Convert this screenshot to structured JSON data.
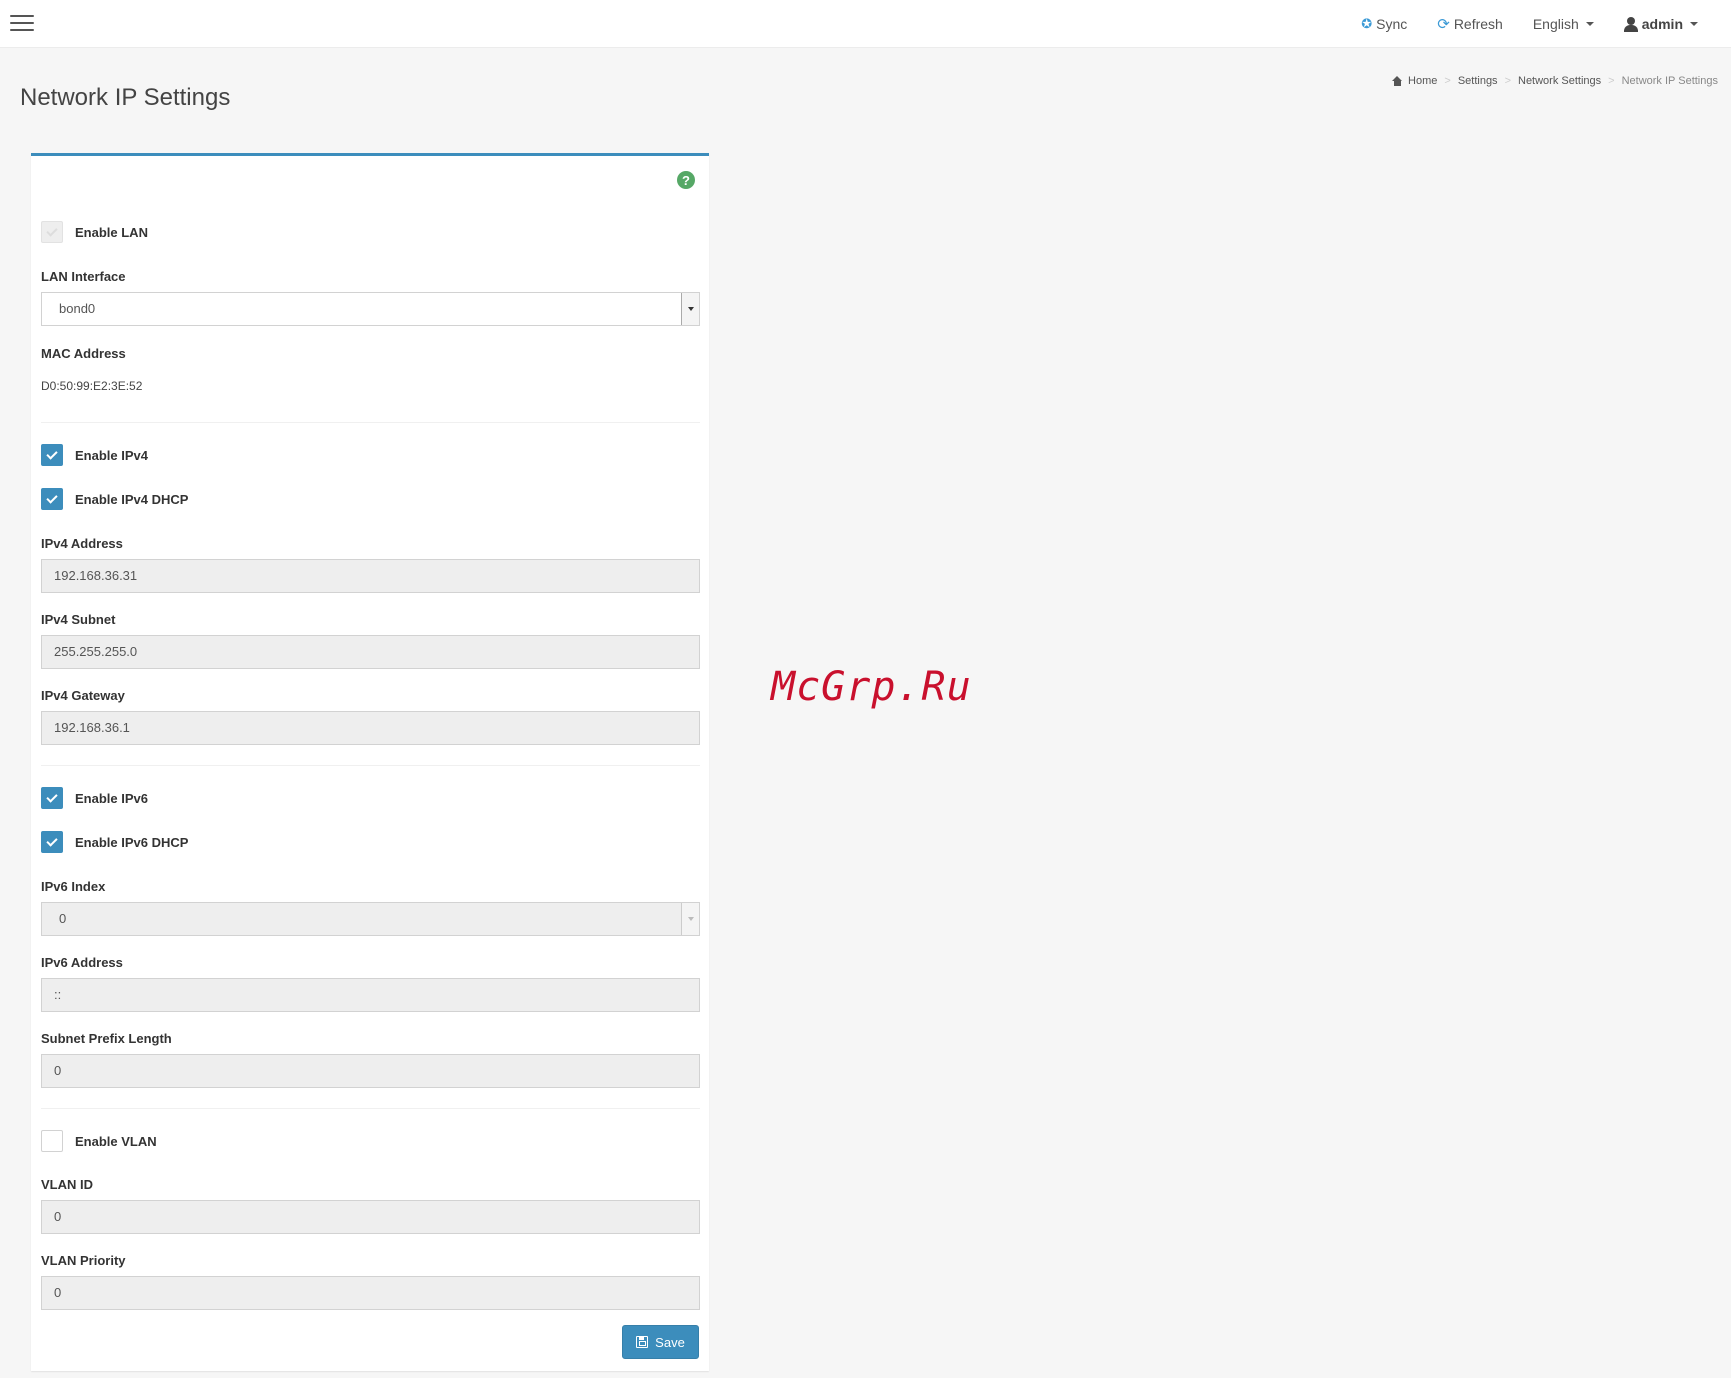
{
  "topbar": {
    "sync_label": "Sync",
    "refresh_label": "Refresh",
    "language_label": "English",
    "user_label": "admin"
  },
  "page": {
    "title": "Network IP Settings"
  },
  "breadcrumb": {
    "home": "Home",
    "settings": "Settings",
    "network_settings": "Network Settings",
    "current": "Network IP Settings"
  },
  "form": {
    "enable_lan": {
      "label": "Enable LAN",
      "checked": true,
      "disabled": true
    },
    "lan_interface": {
      "label": "LAN Interface",
      "value": "bond0"
    },
    "mac_address": {
      "label": "MAC Address",
      "value": "D0:50:99:E2:3E:52"
    },
    "enable_ipv4": {
      "label": "Enable IPv4",
      "checked": true
    },
    "enable_ipv4_dhcp": {
      "label": "Enable IPv4 DHCP",
      "checked": true
    },
    "ipv4_address": {
      "label": "IPv4 Address",
      "value": "192.168.36.31"
    },
    "ipv4_subnet": {
      "label": "IPv4 Subnet",
      "value": "255.255.255.0"
    },
    "ipv4_gateway": {
      "label": "IPv4 Gateway",
      "value": "192.168.36.1"
    },
    "enable_ipv6": {
      "label": "Enable IPv6",
      "checked": true
    },
    "enable_ipv6_dhcp": {
      "label": "Enable IPv6 DHCP",
      "checked": true
    },
    "ipv6_index": {
      "label": "IPv6 Index",
      "value": "0"
    },
    "ipv6_address": {
      "label": "IPv6 Address",
      "value": "::"
    },
    "subnet_prefix_length": {
      "label": "Subnet Prefix Length",
      "value": "0"
    },
    "enable_vlan": {
      "label": "Enable VLAN",
      "checked": false
    },
    "vlan_id": {
      "label": "VLAN ID",
      "value": "0"
    },
    "vlan_priority": {
      "label": "VLAN Priority",
      "value": "0"
    },
    "save_label": "Save"
  },
  "watermark": "McGrp.Ru",
  "colors": {
    "accent": "#3c8dbc",
    "help": "#56a866",
    "watermark": "#c9102d"
  }
}
